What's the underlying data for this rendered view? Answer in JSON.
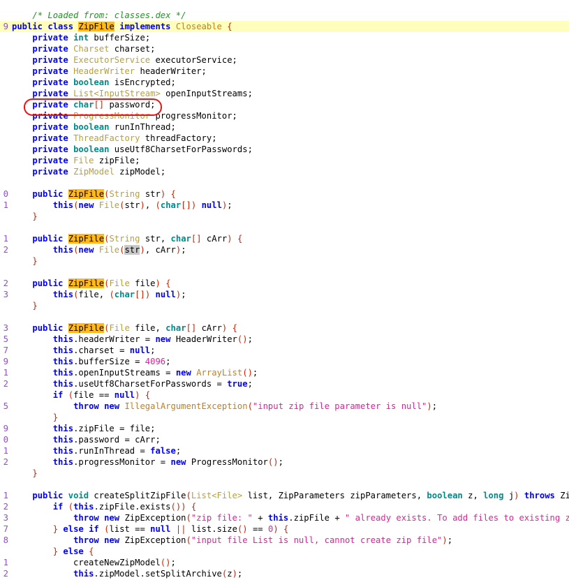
{
  "viewer": {
    "name": "decompiled-code-viewer",
    "current_line_highlight_color": "#ffffbb",
    "occurrence_highlight_color": "#ffb91a",
    "selection_highlight_color": "#c8c8c8",
    "annotation_color": "#f01010",
    "annotation_target": "private char[] password;",
    "background_color": "#ffffff",
    "gutter_color": "#9050c8"
  },
  "palette": {
    "keyword": "#0000ff",
    "primitive": "#008b8b",
    "type": "#b8a038",
    "string": "#e0219a",
    "comment": "#1a9a1a",
    "punctuation": "#cc2200",
    "plain": "#000000"
  },
  "lines": [
    {
      "num": "",
      "cur": false,
      "html": "    <span class=\"cmt\">/* Loaded from: classes.dex */</span>"
    },
    {
      "num": "9",
      "cur": true,
      "html": "<span class=\"kw\">public class</span> <span class=\"hl-occ\">ZipFile</span> <span class=\"kw\">implements</span> <span class=\"cls\">Closeable</span> <span class=\"punc\">{</span>"
    },
    {
      "num": "",
      "cur": false,
      "html": "    <span class=\"kw\">private</span> <span class=\"prim\">int</span> bufferSize<span class=\"plain\">;</span>"
    },
    {
      "num": "",
      "cur": false,
      "html": "    <span class=\"kw\">private</span> <span class=\"type\">Charset</span> charset<span class=\"plain\">;</span>"
    },
    {
      "num": "",
      "cur": false,
      "html": "    <span class=\"kw\">private</span> <span class=\"type\">ExecutorService</span> executorService<span class=\"plain\">;</span>"
    },
    {
      "num": "",
      "cur": false,
      "html": "    <span class=\"kw\">private</span> <span class=\"type\">HeaderWriter</span> headerWriter<span class=\"plain\">;</span>"
    },
    {
      "num": "",
      "cur": false,
      "html": "    <span class=\"kw\">private</span> <span class=\"prim\">boolean</span> isEncrypted<span class=\"plain\">;</span>"
    },
    {
      "num": "",
      "cur": false,
      "html": "    <span class=\"kw\">private</span> <span class=\"type\">List&lt;InputStream&gt;</span> openInputStreams<span class=\"plain\">;</span>"
    },
    {
      "num": "",
      "cur": false,
      "html": "    <span class=\"kw\">private</span> <span class=\"prim\">char</span><span class=\"punc\">[]</span> password<span class=\"plain\">;</span>"
    },
    {
      "num": "",
      "cur": false,
      "html": "    <span class=\"kw\">private</span> <span class=\"type\">ProgressMonitor</span> progressMonitor<span class=\"plain\">;</span>"
    },
    {
      "num": "",
      "cur": false,
      "html": "    <span class=\"kw\">private</span> <span class=\"prim\">boolean</span> runInThread<span class=\"plain\">;</span>"
    },
    {
      "num": "",
      "cur": false,
      "html": "    <span class=\"kw\">private</span> <span class=\"type\">ThreadFactory</span> threadFactory<span class=\"plain\">;</span>"
    },
    {
      "num": "",
      "cur": false,
      "html": "    <span class=\"kw\">private</span> <span class=\"prim\">boolean</span> useUtf8CharsetForPasswords<span class=\"plain\">;</span>"
    },
    {
      "num": "",
      "cur": false,
      "html": "    <span class=\"kw\">private</span> <span class=\"type\">File</span> zipFile<span class=\"plain\">;</span>"
    },
    {
      "num": "",
      "cur": false,
      "html": "    <span class=\"kw\">private</span> <span class=\"type\">ZipModel</span> zipModel<span class=\"plain\">;</span>"
    },
    {
      "num": "",
      "cur": false,
      "html": ""
    },
    {
      "num": "0",
      "cur": false,
      "html": "    <span class=\"kw\">public</span> <span class=\"hl-occ\">ZipFile</span><span class=\"punc\">(</span><span class=\"type\">String</span> str<span class=\"punc\">)</span> <span class=\"punc\">{</span>"
    },
    {
      "num": "1",
      "cur": false,
      "html": "        <span class=\"kw\">this</span><span class=\"punc\">(</span><span class=\"kw\">new</span> <span class=\"type\">File</span><span class=\"punc\">(</span>str<span class=\"punc\">)</span>, <span class=\"punc\">(</span><span class=\"prim\">char</span><span class=\"punc\">[])</span> <span class=\"lit\">null</span><span class=\"punc\">)</span><span class=\"plain\">;</span>"
    },
    {
      "num": "",
      "cur": false,
      "html": "    <span class=\"punc\">}</span>"
    },
    {
      "num": "",
      "cur": false,
      "html": ""
    },
    {
      "num": "1",
      "cur": false,
      "html": "    <span class=\"kw\">public</span> <span class=\"hl-occ\">ZipFile</span><span class=\"punc\">(</span><span class=\"type\">String</span> str, <span class=\"prim\">char</span><span class=\"punc\">[]</span> cArr<span class=\"punc\">)</span> <span class=\"punc\">{</span>"
    },
    {
      "num": "2",
      "cur": false,
      "html": "        <span class=\"kw\">this</span><span class=\"punc\">(</span><span class=\"kw\">new</span> <span class=\"type\">File</span><span class=\"punc\">(</span><span class=\"hl-sel\">str</span><span class=\"punc\">)</span>, cArr<span class=\"punc\">)</span><span class=\"plain\">;</span>"
    },
    {
      "num": "",
      "cur": false,
      "html": "    <span class=\"punc\">}</span>"
    },
    {
      "num": "",
      "cur": false,
      "html": ""
    },
    {
      "num": "2",
      "cur": false,
      "html": "    <span class=\"kw\">public</span> <span class=\"hl-occ\">ZipFile</span><span class=\"punc\">(</span><span class=\"type\">File</span> file<span class=\"punc\">)</span> <span class=\"punc\">{</span>"
    },
    {
      "num": "3",
      "cur": false,
      "html": "        <span class=\"kw\">this</span><span class=\"punc\">(</span>file, <span class=\"punc\">(</span><span class=\"prim\">char</span><span class=\"punc\">[])</span> <span class=\"lit\">null</span><span class=\"punc\">)</span><span class=\"plain\">;</span>"
    },
    {
      "num": "",
      "cur": false,
      "html": "    <span class=\"punc\">}</span>"
    },
    {
      "num": "",
      "cur": false,
      "html": ""
    },
    {
      "num": "3",
      "cur": false,
      "html": "    <span class=\"kw\">public</span> <span class=\"hl-occ\">ZipFile</span><span class=\"punc\">(</span><span class=\"type\">File</span> file, <span class=\"prim\">char</span><span class=\"punc\">[]</span> cArr<span class=\"punc\">)</span> <span class=\"punc\">{</span>"
    },
    {
      "num": "5",
      "cur": false,
      "html": "        <span class=\"kw\">this</span><span class=\"plain\">.</span>headerWriter = <span class=\"kw\">new</span> HeaderWriter<span class=\"punc\">()</span><span class=\"plain\">;</span>"
    },
    {
      "num": "7",
      "cur": false,
      "html": "        <span class=\"kw\">this</span><span class=\"plain\">.</span>charset = <span class=\"lit\">null</span><span class=\"plain\">;</span>"
    },
    {
      "num": "9",
      "cur": false,
      "html": "        <span class=\"kw\">this</span><span class=\"plain\">.</span>bufferSize = <span class=\"num\">4096</span><span class=\"plain\">;</span>"
    },
    {
      "num": "1",
      "cur": false,
      "html": "        <span class=\"kw\">this</span><span class=\"plain\">.</span>openInputStreams = <span class=\"kw\">new</span> <span class=\"cls\">ArrayList</span><span class=\"punc\">()</span><span class=\"plain\">;</span>"
    },
    {
      "num": "2",
      "cur": false,
      "html": "        <span class=\"kw\">this</span><span class=\"plain\">.</span>useUtf8CharsetForPasswords = <span class=\"lit\">true</span><span class=\"plain\">;</span>"
    },
    {
      "num": "",
      "cur": false,
      "html": "        <span class=\"kw\">if</span> <span class=\"punc\">(</span>file == <span class=\"lit\">null</span><span class=\"punc\">)</span> <span class=\"punc\">{</span>"
    },
    {
      "num": "5",
      "cur": false,
      "html": "            <span class=\"kw\">throw</span> <span class=\"kw\">new</span> <span class=\"cls\">IllegalArgumentException</span><span class=\"punc\">(</span><span class=\"str\">\"input zip file parameter is null\"</span><span class=\"punc\">)</span><span class=\"plain\">;</span>"
    },
    {
      "num": "",
      "cur": false,
      "html": "        <span class=\"punc\">}</span>"
    },
    {
      "num": "9",
      "cur": false,
      "html": "        <span class=\"kw\">this</span><span class=\"plain\">.</span>zipFile = file<span class=\"plain\">;</span>"
    },
    {
      "num": "0",
      "cur": false,
      "html": "        <span class=\"kw\">this</span><span class=\"plain\">.</span>password = cArr<span class=\"plain\">;</span>"
    },
    {
      "num": "1",
      "cur": false,
      "html": "        <span class=\"kw\">this</span><span class=\"plain\">.</span>runInThread = <span class=\"lit\">false</span><span class=\"plain\">;</span>"
    },
    {
      "num": "2",
      "cur": false,
      "html": "        <span class=\"kw\">this</span><span class=\"plain\">.</span>progressMonitor = <span class=\"kw\">new</span> ProgressMonitor<span class=\"punc\">()</span><span class=\"plain\">;</span>"
    },
    {
      "num": "",
      "cur": false,
      "html": "    <span class=\"punc\">}</span>"
    },
    {
      "num": "",
      "cur": false,
      "html": ""
    },
    {
      "num": "1",
      "cur": false,
      "html": "    <span class=\"kw\">public</span> <span class=\"prim\">void</span> createSplitZipFile<span class=\"punc\">(</span><span class=\"type\">List&lt;File&gt;</span> list, ZipParameters zipParameters, <span class=\"prim\">boolean</span> z, <span class=\"prim\">long</span> j<span class=\"punc\">)</span> <span class=\"kw\">throws</span> ZipException <span class=\"punc\">{</span>"
    },
    {
      "num": "2",
      "cur": false,
      "html": "        <span class=\"kw\">if</span> <span class=\"punc\">(</span><span class=\"kw\">this</span><span class=\"plain\">.</span>zipFile<span class=\"plain\">.</span>exists<span class=\"punc\">())</span> <span class=\"punc\">{</span>"
    },
    {
      "num": "3",
      "cur": false,
      "html": "            <span class=\"kw\">throw</span> <span class=\"kw\">new</span> ZipException<span class=\"punc\">(</span><span class=\"str\">\"zip file: \"</span> + <span class=\"kw\">this</span><span class=\"plain\">.</span>zipFile + <span class=\"str\">\" already exists. To add files to existing zip file\"</span><span class=\"punc\">)</span><span class=\"plain\">;</span>"
    },
    {
      "num": "7",
      "cur": false,
      "html": "        <span class=\"punc\">}</span> <span class=\"kw\">else if</span> <span class=\"punc\">(</span>list == <span class=\"lit\">null</span> <span class=\"punc\">||</span> list<span class=\"plain\">.</span>size<span class=\"punc\">()</span> == <span class=\"num\">0</span><span class=\"punc\">)</span> <span class=\"punc\">{</span>"
    },
    {
      "num": "8",
      "cur": false,
      "html": "            <span class=\"kw\">throw</span> <span class=\"kw\">new</span> ZipException<span class=\"punc\">(</span><span class=\"str\">\"input file List is null, cannot create zip file\"</span><span class=\"punc\">)</span><span class=\"plain\">;</span>"
    },
    {
      "num": "",
      "cur": false,
      "html": "        <span class=\"punc\">}</span> <span class=\"kw\">else</span> <span class=\"punc\">{</span>"
    },
    {
      "num": "1",
      "cur": false,
      "html": "            createNewZipModel<span class=\"punc\">()</span><span class=\"plain\">;</span>"
    },
    {
      "num": "2",
      "cur": false,
      "html": "            <span class=\"kw\">this</span><span class=\"plain\">.</span>zipModel<span class=\"plain\">.</span>setSplitArchive<span class=\"punc\">(</span>z<span class=\"punc\">)</span><span class=\"plain\">;</span>"
    }
  ]
}
